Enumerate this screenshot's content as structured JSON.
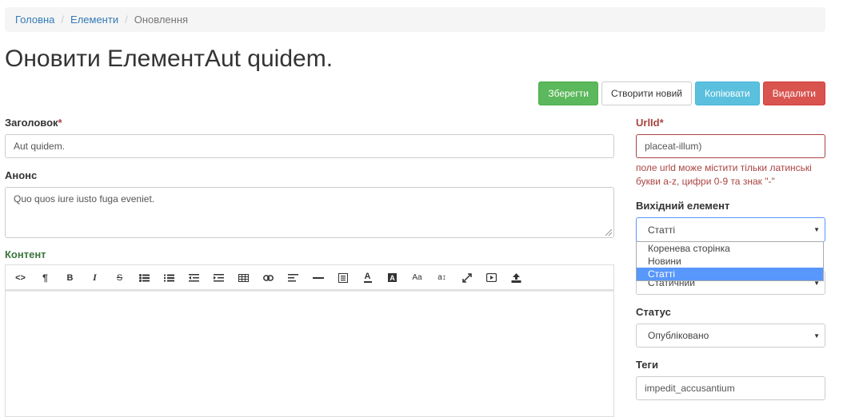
{
  "breadcrumb": {
    "home": "Головна",
    "elements": "Елементи",
    "current": "Оновлення",
    "separator": "/"
  },
  "page_title": "Оновити ЕлементAut quidem.",
  "actions": {
    "save": "Зберегти",
    "create_new": "Створити новий",
    "copy": "Копіювати",
    "delete": "Видалити"
  },
  "form": {
    "title_label": "Заголовок",
    "title_value": "Aut quidem.",
    "announce_label": "Анонс",
    "announce_value": "Quo quos iure iusto fuga eveniet.",
    "content_label": "Контент",
    "urlid_label": "UrlId",
    "urlid_value": "placeat-illum)",
    "urlid_error": "поле urld може містити тільки латинські букви a-z, цифри 0-9 та знак \"-\"",
    "source_label": "Вихідний елемент",
    "source_value": "Статті",
    "source_options": [
      "Коренева сторінка",
      "Новини",
      "Статті"
    ],
    "type_value": "Статичний",
    "status_label": "Статус",
    "status_value": "Опубліковано",
    "tags_label": "Теги",
    "tags_value": "impedit_accusantium",
    "required_mark": "*"
  },
  "toolbar_icons": [
    "code-view-icon",
    "paragraph-icon",
    "bold-icon",
    "italic-icon",
    "strikethrough-icon",
    "unordered-list-icon",
    "ordered-list-icon",
    "outdent-icon",
    "indent-icon",
    "table-icon",
    "link-icon",
    "align-icon",
    "horizontal-rule-icon",
    "block-icon",
    "font-color-icon",
    "background-color-icon",
    "font-size-icon",
    "formatting-icon",
    "fullscreen-icon",
    "video-icon",
    "upload-icon"
  ],
  "toolbar_glyphs": {
    "code": "<>",
    "paragraph": "¶",
    "bold": "B",
    "italic": "I",
    "strike": "S",
    "font_size": "Aa",
    "formatting": "a↕",
    "font_color": "A",
    "bg_color": "A"
  }
}
